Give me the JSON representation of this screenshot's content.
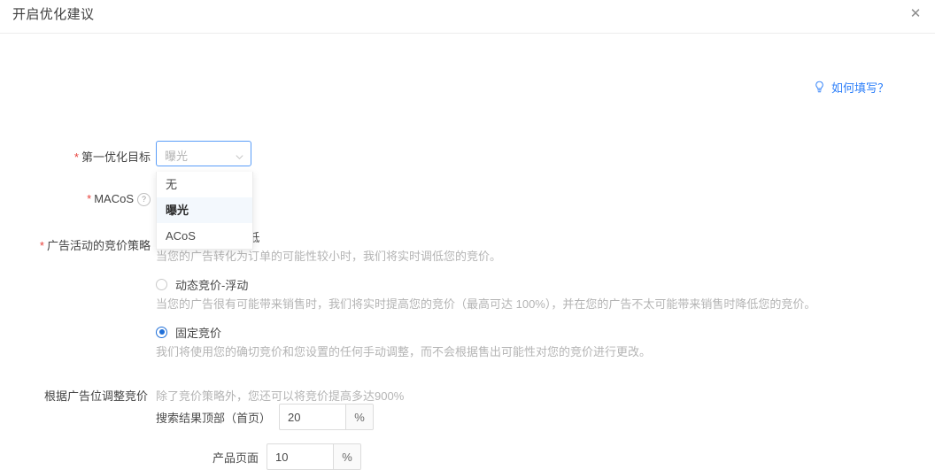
{
  "header": {
    "title": "开启优化建议",
    "close_icon": "close-icon",
    "close_label": "✕"
  },
  "help": {
    "icon": "lightbulb-icon",
    "label": "如何填写？",
    "color": "#2d7ff9"
  },
  "form": {
    "goal": {
      "required": "*",
      "label": "第一优化目标",
      "selected_value": "曝光",
      "chevron_icon": "chevron-down-icon",
      "dropdown_open": true,
      "options": [
        {
          "label": "无",
          "selected": false
        },
        {
          "label": "曝光",
          "selected": true
        },
        {
          "label": "ACoS",
          "selected": false
        }
      ]
    },
    "macos": {
      "required": "*",
      "label": "MACoS",
      "help_icon": "question-mark-icon",
      "help_glyph": "?"
    },
    "bid_strategy": {
      "required": "*",
      "label": "广告活动的竞价策略",
      "options": [
        {
          "label": "动态竞价-只降低",
          "desc": "当您的广告转化为订单的可能性较小时，我们将实时调低您的竞价。",
          "checked": false
        },
        {
          "label": "动态竞价-浮动",
          "desc": "当您的广告很有可能带来销售时，我们将实时提高您的竞价（最高可达 100%），并在您的广告不太可能带来销售时降低您的竞价。",
          "checked": false
        },
        {
          "label": "固定竞价",
          "desc": "我们将使用您的确切竞价和您设置的任何手动调整，而不会根据售出可能性对您的竞价进行更改。",
          "checked": true
        }
      ]
    },
    "placement": {
      "label": "根据广告位调整竞价",
      "note": "除了竞价策略外，您还可以将竞价提高多达900%",
      "rows": [
        {
          "name": "搜索结果顶部（首页）",
          "value": "20",
          "unit": "%",
          "placeholder": ""
        },
        {
          "name": "产品页面",
          "value": "10",
          "unit": "%",
          "placeholder": ""
        }
      ]
    }
  },
  "colors": {
    "accent": "#2d7ff9",
    "required": "#e8403a",
    "border": "#dcdcdc",
    "muted_text": "#b4b4b4"
  }
}
